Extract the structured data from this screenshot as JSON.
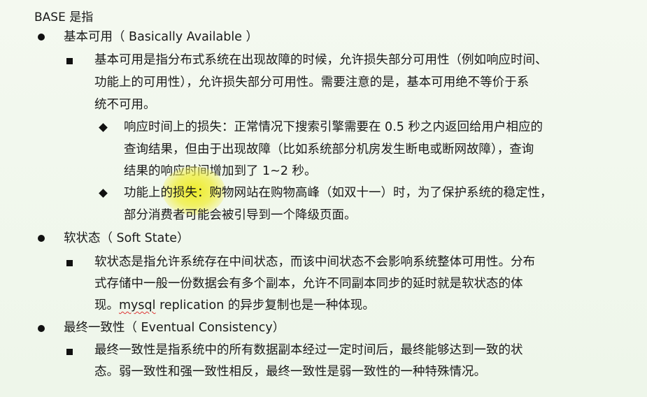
{
  "title": "BASE 是指",
  "sections": [
    {
      "heading": "基本可用（ Basically Available ）",
      "body_lines": [
        "基本可用是指分布式系统在出现故障的时候，允许损失部分可用性（例如响应时间、",
        "功能上的可用性），允许损失部分可用性。需要注意的是，基本可用绝不等价于系",
        "统不可用。"
      ],
      "sub_items": [
        {
          "lines": [
            "响应时间上的损失：正常情况下搜索引擎需要在 0.5 秒之内返回给用户相应的",
            "查询结果，但由于出现故障（比如系统部分机房发生断电或断网故障），查询",
            "结果的响应时间增加到了 1~2 秒。"
          ]
        },
        {
          "lines": [
            "功能上的损失：购物网站在购物高峰（如双十一）时，为了保护系统的稳定性，",
            "部分消费者可能会被引导到一个降级页面。"
          ]
        }
      ]
    },
    {
      "heading": "软状态（  Soft State）",
      "body_lines": [
        "软状态是指允许系统存在中间状态，而该中间状态不会影响系统整体可用性。分布",
        "式存储中一般一份数据会有多个副本，允许不同副本同步的延时就是软状态的体"
      ],
      "body_last_line": {
        "before": "现。",
        "marked": "mysql",
        "after": " replication 的异步复制也是一种体现。"
      }
    },
    {
      "heading": "最终一致性（  Eventual Consistency）",
      "body_lines": [
        "最终一致性是指系统中的所有数据副本经过一定时间后，最终能够达到一致的状",
        "态。弱一致性和强一致性相反，最终一致性是弱一致性的一种特殊情况。"
      ]
    }
  ]
}
